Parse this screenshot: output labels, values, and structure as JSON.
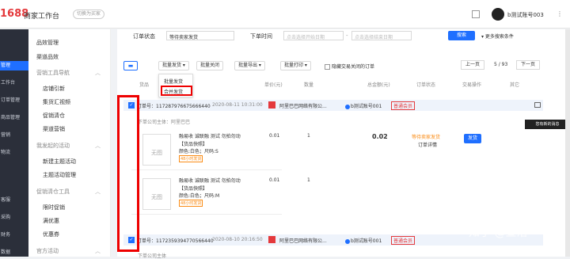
{
  "header": {
    "logo": "1688",
    "title": "商家工作台",
    "switch_label": "切换为买家",
    "account": "b测试账号003"
  },
  "left_nav": [
    "管理",
    "工作台",
    "订单管理",
    "商品管理",
    "营销",
    "物流",
    "客服",
    "采购",
    "财务",
    "数据",
    "设置"
  ],
  "side_nav": {
    "items": [
      {
        "label": "品效管理"
      },
      {
        "label": "渠道品效"
      }
    ],
    "groups": [
      {
        "label": "营销工具导航",
        "subs": [
          "店铺引新",
          "集货汇视频",
          "促销清仓",
          "渠道营销"
        ]
      },
      {
        "label": "我发起的活动",
        "subs": [
          "新建主题活动",
          "主题活动管理"
        ]
      },
      {
        "label": "促销清仓工具",
        "subs": [
          "限时促销",
          "满优惠",
          "优惠券"
        ]
      },
      {
        "label": "官方活动",
        "subs": []
      }
    ]
  },
  "filter": {
    "status_label": "订单状态",
    "status_value": "等待卖家发货",
    "time_label": "下单时间",
    "start_placeholder": "点击选择开始日期",
    "end_placeholder": "点击选择结束日期",
    "search_label": "搜索",
    "more_label": "更多搜索条件"
  },
  "toolbar": {
    "batch_ship": "批量发货",
    "batch_close": "批量关闭",
    "batch_export": "批量导出",
    "batch_print": "批量打印",
    "hide_closed": "隐藏交易关闭的订单",
    "prev": "上一页",
    "page": "5 / 93",
    "next": "下一页"
  },
  "dropdown": {
    "item1": "批量发货",
    "item2": "合并发货"
  },
  "columns": [
    "货品",
    "单价(元)",
    "数量",
    "总金额(元)",
    "订单状态",
    "交易操作",
    "其它"
  ],
  "tooltip": "您有新的消息",
  "orders": [
    {
      "id_label": "订单号：1172879766756664​40",
      "time": "2020-08-11 10:31:00",
      "shop": "阿里巴巴网络有限公...",
      "buyer": "b测试账号001",
      "member": "普通会员",
      "subject": "下单公司主体：阿里巴巴",
      "products": [
        {
          "thumb": "无图",
          "title": "融易收 诚联融 测试 勿拍勿动",
          "spec1": "【货品快照】",
          "spec2": "颜色:白色；尺码:S",
          "tag": "48小时发货",
          "price": "0.01",
          "qty": "1"
        },
        {
          "thumb": "无图",
          "title": "融易收 诚联融 测试 勿拍勿动",
          "spec1": "【货品快照】",
          "spec2": "颜色:白色；尺码:M",
          "tag": "48小时发货",
          "price": "0.01",
          "qty": "1"
        }
      ],
      "total": "0.02",
      "status": "等待卖家发货",
      "detail": "订单详情",
      "ship": "发货"
    },
    {
      "id_label": "订单号：1172359394770566440",
      "time": "2020-08-10 20:16:50",
      "shop": "阿里巴巴网络有限公...",
      "buyer": "b测试账号001",
      "member": "普通会员",
      "subject": "下单公司主体"
    }
  ],
  "watermark": "知乎 @查洛"
}
